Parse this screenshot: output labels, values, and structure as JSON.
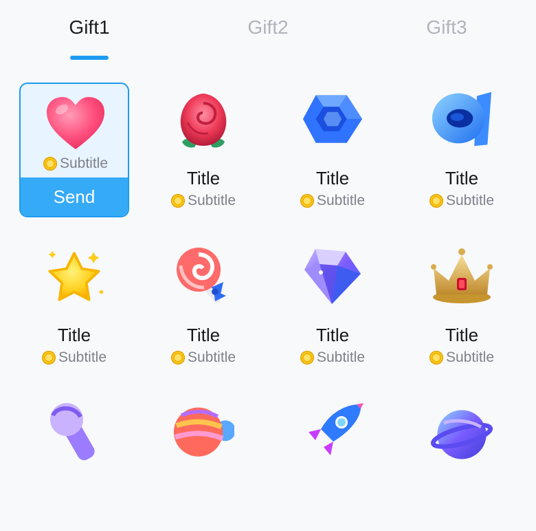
{
  "tabs": [
    {
      "label": "Gift1",
      "active": true
    },
    {
      "label": "Gift2",
      "active": false
    },
    {
      "label": "Gift3",
      "active": false
    }
  ],
  "send_label": "Send",
  "gifts": [
    {
      "icon": "heart-icon",
      "title": "",
      "subtitle": "Subtitle",
      "selected": true
    },
    {
      "icon": "rose-icon",
      "title": "Title",
      "subtitle": "Subtitle"
    },
    {
      "icon": "blue-cube-icon",
      "title": "Title",
      "subtitle": "Subtitle"
    },
    {
      "icon": "blue-ring-icon",
      "title": "Title",
      "subtitle": "Subtitle"
    },
    {
      "icon": "star-icon",
      "title": "Title",
      "subtitle": "Subtitle"
    },
    {
      "icon": "lollipop-icon",
      "title": "Title",
      "subtitle": "Subtitle"
    },
    {
      "icon": "diamond-icon",
      "title": "Title",
      "subtitle": "Subtitle"
    },
    {
      "icon": "crown-icon",
      "title": "Title",
      "subtitle": "Subtitle"
    },
    {
      "icon": "microphone-icon",
      "title": "",
      "subtitle": ""
    },
    {
      "icon": "hot-air-balloon-icon",
      "title": "",
      "subtitle": ""
    },
    {
      "icon": "rocket-icon",
      "title": "",
      "subtitle": ""
    },
    {
      "icon": "planet-icon",
      "title": "",
      "subtitle": ""
    }
  ],
  "colors": {
    "accent": "#1d9bf0",
    "send_bar": "#35aaf6",
    "coin": "#f5b800"
  }
}
